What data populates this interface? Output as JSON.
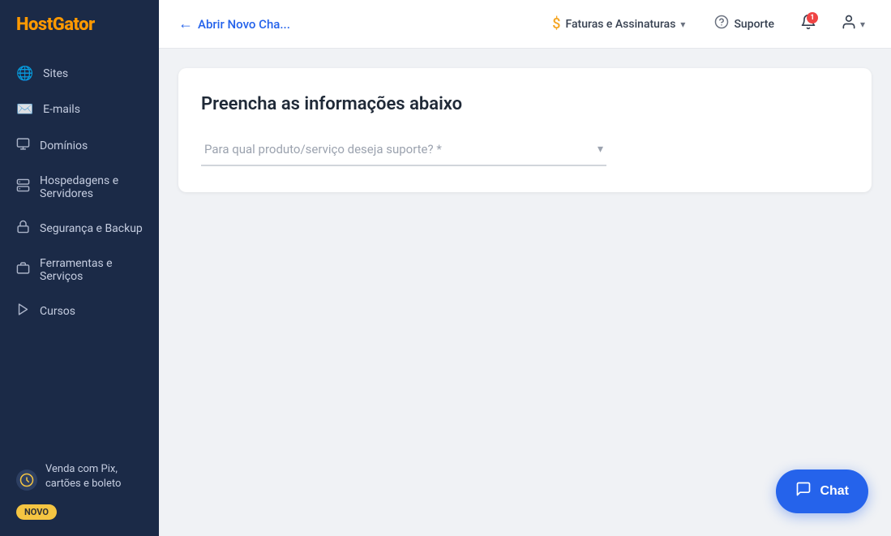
{
  "sidebar": {
    "logo": "HostGator",
    "items": [
      {
        "id": "sites",
        "label": "Sites",
        "icon": "🌐"
      },
      {
        "id": "emails",
        "label": "E-mails",
        "icon": "✉️"
      },
      {
        "id": "domains",
        "label": "Domínios",
        "icon": "🖥"
      },
      {
        "id": "hosting",
        "label": "Hospedagens e Servidores",
        "icon": "🗂"
      },
      {
        "id": "security",
        "label": "Segurança e Backup",
        "icon": "🔒"
      },
      {
        "id": "tools",
        "label": "Ferramentas e Serviços",
        "icon": "🧰"
      },
      {
        "id": "courses",
        "label": "Cursos",
        "icon": "▶"
      }
    ],
    "promo": {
      "text": "Venda com Pix, cartões e boleto",
      "badge": "NOVO"
    }
  },
  "header": {
    "back_label": "Abrir Novo Cha...",
    "billing_label": "Faturas e Assinaturas",
    "support_label": "Suporte",
    "notif_count": "1"
  },
  "main": {
    "card_title": "Preencha as informações abaixo",
    "dropdown_placeholder": "Para qual produto/serviço deseja suporte? *"
  },
  "chat_button": {
    "label": "Chat"
  }
}
